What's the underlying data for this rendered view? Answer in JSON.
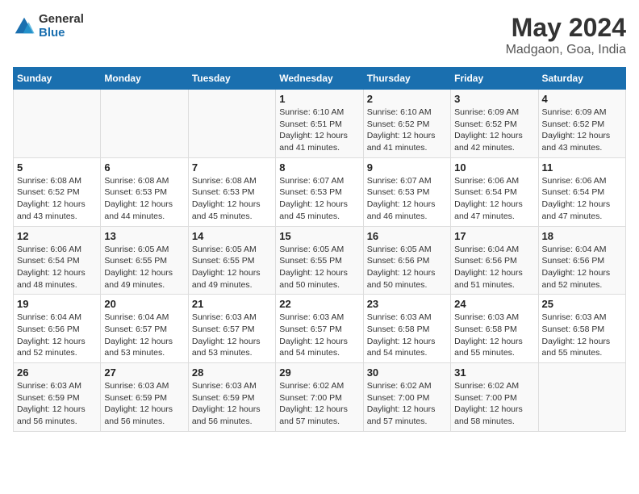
{
  "logo": {
    "general": "General",
    "blue": "Blue"
  },
  "header": {
    "title": "May 2024",
    "subtitle": "Madgaon, Goa, India"
  },
  "weekdays": [
    "Sunday",
    "Monday",
    "Tuesday",
    "Wednesday",
    "Thursday",
    "Friday",
    "Saturday"
  ],
  "weeks": [
    [
      {
        "num": "",
        "info": ""
      },
      {
        "num": "",
        "info": ""
      },
      {
        "num": "",
        "info": ""
      },
      {
        "num": "1",
        "info": "Sunrise: 6:10 AM\nSunset: 6:51 PM\nDaylight: 12 hours and 41 minutes."
      },
      {
        "num": "2",
        "info": "Sunrise: 6:10 AM\nSunset: 6:52 PM\nDaylight: 12 hours and 41 minutes."
      },
      {
        "num": "3",
        "info": "Sunrise: 6:09 AM\nSunset: 6:52 PM\nDaylight: 12 hours and 42 minutes."
      },
      {
        "num": "4",
        "info": "Sunrise: 6:09 AM\nSunset: 6:52 PM\nDaylight: 12 hours and 43 minutes."
      }
    ],
    [
      {
        "num": "5",
        "info": "Sunrise: 6:08 AM\nSunset: 6:52 PM\nDaylight: 12 hours and 43 minutes."
      },
      {
        "num": "6",
        "info": "Sunrise: 6:08 AM\nSunset: 6:53 PM\nDaylight: 12 hours and 44 minutes."
      },
      {
        "num": "7",
        "info": "Sunrise: 6:08 AM\nSunset: 6:53 PM\nDaylight: 12 hours and 45 minutes."
      },
      {
        "num": "8",
        "info": "Sunrise: 6:07 AM\nSunset: 6:53 PM\nDaylight: 12 hours and 45 minutes."
      },
      {
        "num": "9",
        "info": "Sunrise: 6:07 AM\nSunset: 6:53 PM\nDaylight: 12 hours and 46 minutes."
      },
      {
        "num": "10",
        "info": "Sunrise: 6:06 AM\nSunset: 6:54 PM\nDaylight: 12 hours and 47 minutes."
      },
      {
        "num": "11",
        "info": "Sunrise: 6:06 AM\nSunset: 6:54 PM\nDaylight: 12 hours and 47 minutes."
      }
    ],
    [
      {
        "num": "12",
        "info": "Sunrise: 6:06 AM\nSunset: 6:54 PM\nDaylight: 12 hours and 48 minutes."
      },
      {
        "num": "13",
        "info": "Sunrise: 6:05 AM\nSunset: 6:55 PM\nDaylight: 12 hours and 49 minutes."
      },
      {
        "num": "14",
        "info": "Sunrise: 6:05 AM\nSunset: 6:55 PM\nDaylight: 12 hours and 49 minutes."
      },
      {
        "num": "15",
        "info": "Sunrise: 6:05 AM\nSunset: 6:55 PM\nDaylight: 12 hours and 50 minutes."
      },
      {
        "num": "16",
        "info": "Sunrise: 6:05 AM\nSunset: 6:56 PM\nDaylight: 12 hours and 50 minutes."
      },
      {
        "num": "17",
        "info": "Sunrise: 6:04 AM\nSunset: 6:56 PM\nDaylight: 12 hours and 51 minutes."
      },
      {
        "num": "18",
        "info": "Sunrise: 6:04 AM\nSunset: 6:56 PM\nDaylight: 12 hours and 52 minutes."
      }
    ],
    [
      {
        "num": "19",
        "info": "Sunrise: 6:04 AM\nSunset: 6:56 PM\nDaylight: 12 hours and 52 minutes."
      },
      {
        "num": "20",
        "info": "Sunrise: 6:04 AM\nSunset: 6:57 PM\nDaylight: 12 hours and 53 minutes."
      },
      {
        "num": "21",
        "info": "Sunrise: 6:03 AM\nSunset: 6:57 PM\nDaylight: 12 hours and 53 minutes."
      },
      {
        "num": "22",
        "info": "Sunrise: 6:03 AM\nSunset: 6:57 PM\nDaylight: 12 hours and 54 minutes."
      },
      {
        "num": "23",
        "info": "Sunrise: 6:03 AM\nSunset: 6:58 PM\nDaylight: 12 hours and 54 minutes."
      },
      {
        "num": "24",
        "info": "Sunrise: 6:03 AM\nSunset: 6:58 PM\nDaylight: 12 hours and 55 minutes."
      },
      {
        "num": "25",
        "info": "Sunrise: 6:03 AM\nSunset: 6:58 PM\nDaylight: 12 hours and 55 minutes."
      }
    ],
    [
      {
        "num": "26",
        "info": "Sunrise: 6:03 AM\nSunset: 6:59 PM\nDaylight: 12 hours and 56 minutes."
      },
      {
        "num": "27",
        "info": "Sunrise: 6:03 AM\nSunset: 6:59 PM\nDaylight: 12 hours and 56 minutes."
      },
      {
        "num": "28",
        "info": "Sunrise: 6:03 AM\nSunset: 6:59 PM\nDaylight: 12 hours and 56 minutes."
      },
      {
        "num": "29",
        "info": "Sunrise: 6:02 AM\nSunset: 7:00 PM\nDaylight: 12 hours and 57 minutes."
      },
      {
        "num": "30",
        "info": "Sunrise: 6:02 AM\nSunset: 7:00 PM\nDaylight: 12 hours and 57 minutes."
      },
      {
        "num": "31",
        "info": "Sunrise: 6:02 AM\nSunset: 7:00 PM\nDaylight: 12 hours and 58 minutes."
      },
      {
        "num": "",
        "info": ""
      }
    ]
  ]
}
